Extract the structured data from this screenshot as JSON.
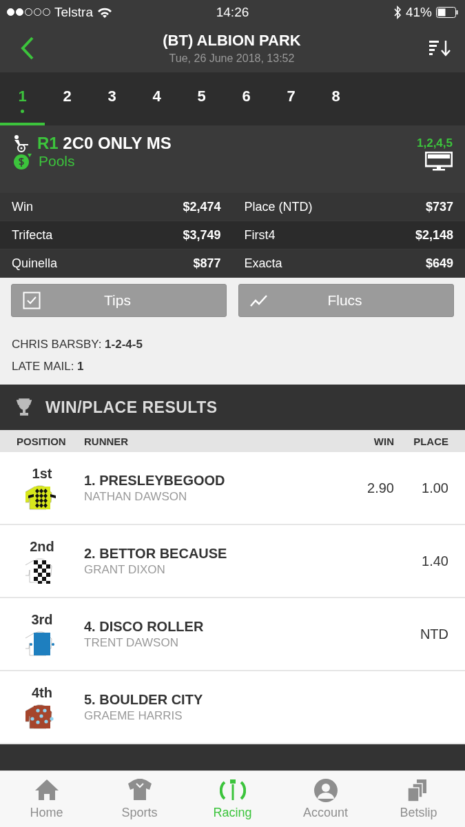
{
  "status_bar": {
    "carrier": "Telstra",
    "time": "14:26",
    "battery": "41%"
  },
  "header": {
    "title": "(BT) ALBION PARK",
    "subtitle": "Tue, 26 June 2018, 13:52"
  },
  "race_tabs": [
    {
      "label": "1",
      "selected": true
    },
    {
      "label": "2",
      "selected": false
    },
    {
      "label": "3",
      "selected": false
    },
    {
      "label": "4",
      "selected": false
    },
    {
      "label": "5",
      "selected": false
    },
    {
      "label": "6",
      "selected": false
    },
    {
      "label": "7",
      "selected": false
    },
    {
      "label": "8",
      "selected": false
    }
  ],
  "race": {
    "number": "R1",
    "name": "2C0 ONLY MS",
    "result": "1,2,4,5",
    "pools_label": "Pools"
  },
  "pools": [
    {
      "label": "Win",
      "value": "$2,474"
    },
    {
      "label": "Place (NTD)",
      "value": "$737"
    },
    {
      "label": "Trifecta",
      "value": "$3,749"
    },
    {
      "label": "First4",
      "value": "$2,148"
    },
    {
      "label": "Quinella",
      "value": "$877"
    },
    {
      "label": "Exacta",
      "value": "$649"
    }
  ],
  "buttons": [
    {
      "kind": "tips",
      "label": "Tips"
    },
    {
      "kind": "flucs",
      "label": "Flucs"
    }
  ],
  "tips": [
    {
      "label": "CHRIS BARSBY:",
      "value": "1-2-4-5"
    },
    {
      "label": "LATE MAIL:",
      "value": "1"
    }
  ],
  "win_place_results": {
    "title": "WIN/PLACE RESULTS",
    "columns": [
      "POSITION",
      "RUNNER",
      "WIN",
      "PLACE"
    ],
    "rows": [
      {
        "position": "1st",
        "kind": "diamonds",
        "runner": "1. PRESLEYBEGOOD",
        "jockey": "NATHAN DAWSON",
        "win": "2.90",
        "place": "1.00"
      },
      {
        "position": "2nd",
        "kind": "checks",
        "runner": "2. BETTOR BECAUSE",
        "jockey": "GRANT DIXON",
        "place": "1.40"
      },
      {
        "position": "3rd",
        "kind": "plain",
        "runner": "4. DISCO ROLLER",
        "jockey": "TRENT DAWSON",
        "place": "NTD"
      },
      {
        "position": "4th",
        "kind": "spots",
        "runner": "5. BOULDER CITY",
        "jockey": "GRAEME HARRIS"
      }
    ]
  },
  "bottom_nav": [
    {
      "kind": "home",
      "label": "Home",
      "selected": false
    },
    {
      "kind": "sports",
      "label": "Sports",
      "selected": false
    },
    {
      "kind": "racing",
      "label": "Racing",
      "selected": true
    },
    {
      "kind": "account",
      "label": "Account",
      "selected": false
    },
    {
      "kind": "betslip",
      "label": "Betslip",
      "selected": false
    }
  ]
}
